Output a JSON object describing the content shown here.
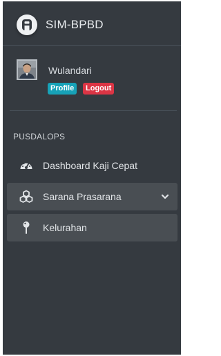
{
  "brand": {
    "title": "SIM-BPBD",
    "logo_icon": "letter-a-logo-icon"
  },
  "user": {
    "name": "Wulandari",
    "avatar_icon": "user-avatar-icon",
    "profile_label": "Profile",
    "logout_label": "Logout"
  },
  "nav": {
    "header": "PUSDALOPS",
    "items": [
      {
        "label": "Dashboard Kaji Cepat",
        "icon": "tachometer-icon",
        "active": false
      },
      {
        "label": "Sarana Prasarana",
        "icon": "cubes-icon",
        "active": true,
        "expandable": true
      },
      {
        "label": "Kelurahan",
        "icon": "map-pin-icon",
        "active": true
      }
    ]
  },
  "colors": {
    "sidebar_bg": "#353a40",
    "active_bg": "#494e53",
    "profile_badge": "#17a2b8",
    "logout_badge": "#dc3545"
  }
}
